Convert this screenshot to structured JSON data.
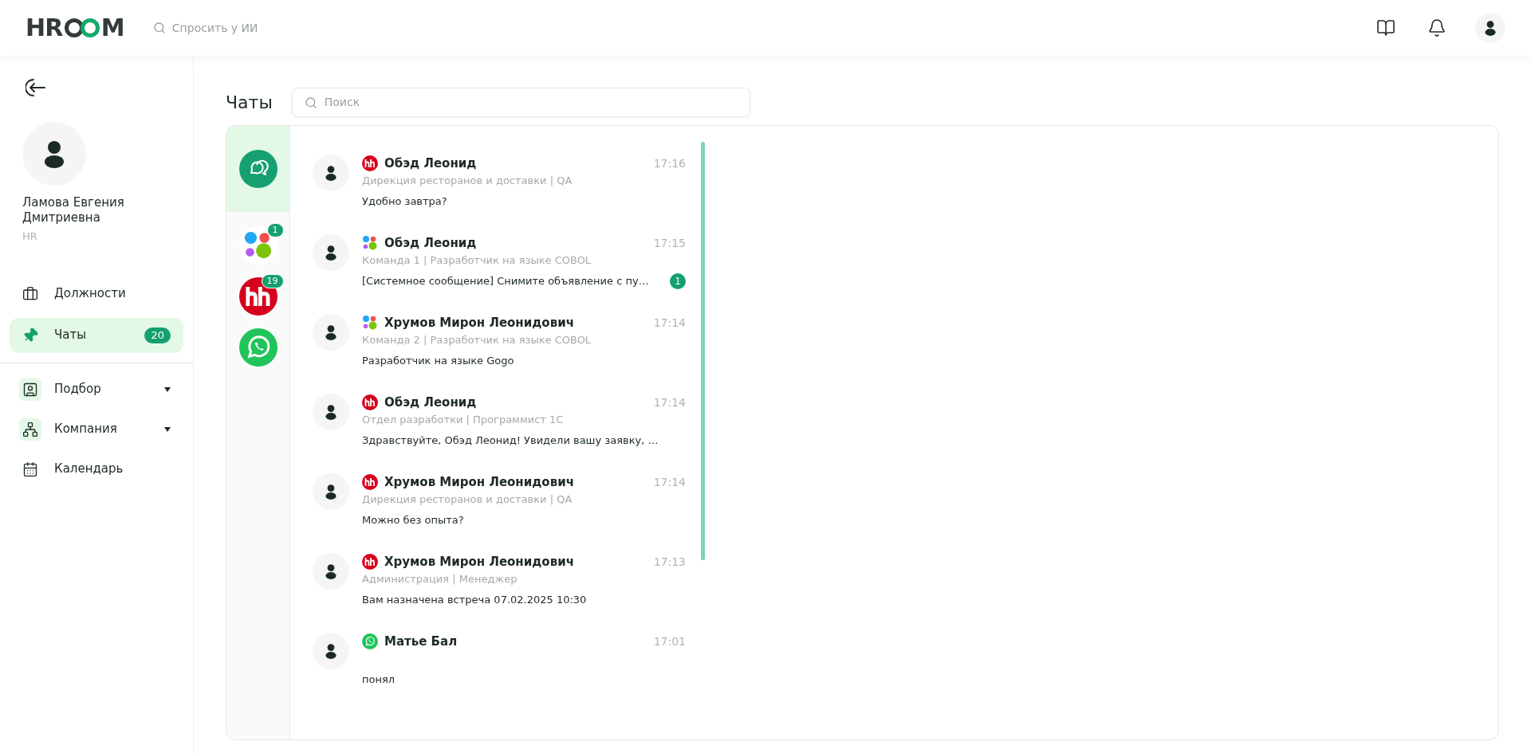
{
  "header": {
    "logo": {
      "left": "HR",
      "right": "M"
    },
    "ai_search": {
      "placeholder": "Спросить у ИИ"
    }
  },
  "sidebar": {
    "user": {
      "name": "Ламова Евгения Дмитриевна",
      "role": "HR"
    },
    "items": [
      {
        "kind": "briefcase",
        "label": "Должности",
        "selected": false
      },
      {
        "kind": "pin",
        "label": "Чаты",
        "selected": true,
        "badge": "20"
      }
    ],
    "groups": [
      {
        "kind": "recruit",
        "label": "Подбор",
        "expandable": true,
        "tinted": true
      },
      {
        "kind": "company",
        "label": "Компания",
        "expandable": true,
        "tinted": true
      },
      {
        "kind": "calendar",
        "label": "Календарь",
        "expandable": false,
        "tinted": false
      }
    ]
  },
  "page": {
    "title": "Чаты",
    "search": {
      "placeholder": "Поиск"
    }
  },
  "sources": [
    {
      "kind": "all",
      "selected": true
    },
    {
      "kind": "team",
      "selected": false,
      "badge": "1"
    },
    {
      "kind": "hh",
      "selected": false,
      "badge": "19"
    },
    {
      "kind": "whatsapp",
      "selected": false
    }
  ],
  "chats": [
    {
      "kind": "hh",
      "name": "Обэд Леонид",
      "time": "17:16",
      "subtitle": "Дирекция ресторанов и доставки | QA",
      "message": "Удобно завтра?"
    },
    {
      "kind": "team",
      "name": "Обэд Леонид",
      "time": "17:15",
      "subtitle": "Команда 1 | Разработчик на языке COBOL",
      "message": "[Системное сообщение] Снимите объявление с пу…",
      "unread": "1"
    },
    {
      "kind": "team",
      "name": "Хрумов Мирон Леонидович",
      "time": "17:14",
      "subtitle": "Команда 2 | Разработчик на языке COBOL",
      "message": "Разработчик на языке Gogo"
    },
    {
      "kind": "hh",
      "name": "Обэд Леонид",
      "time": "17:14",
      "subtitle": "Отдел разработки | Программист 1С",
      "message": "Здравствуйте, Обэд Леонид! Увидели вашу заявку, …"
    },
    {
      "kind": "hh",
      "name": "Хрумов Мирон Леонидович",
      "time": "17:14",
      "subtitle": "Дирекция ресторанов и доставки | QA",
      "message": "Можно без опыта?"
    },
    {
      "kind": "hh",
      "name": "Хрумов Мирон Леонидович",
      "time": "17:13",
      "subtitle": "Администрация | Менеджер",
      "message": "Вам назначена встреча 07.02.2025 10:30"
    },
    {
      "kind": "whatsapp",
      "name": "Матье Бал",
      "time": "17:01",
      "message": "понял"
    }
  ]
}
